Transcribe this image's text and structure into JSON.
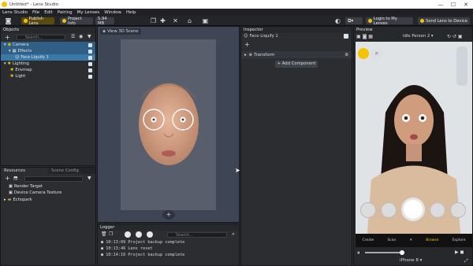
{
  "window": {
    "title": "Untitled* - Lens Studio",
    "minimize": "—",
    "maximize": "☐",
    "close": "✕"
  },
  "menu": [
    "Lens Studio",
    "File",
    "Edit",
    "Pairing",
    "My Lenses",
    "Window",
    "Help"
  ],
  "toolbar": {
    "publish": "Publish Lens",
    "project_info": "Project Info",
    "size": "5.94 MB",
    "login": "Login to My Lenses",
    "send": "Send Lens to Device"
  },
  "objects": {
    "title": "Objects",
    "search_placeholder": "Search...",
    "items": [
      {
        "label": "Camera"
      },
      {
        "label": "Effects"
      },
      {
        "label": "Face Liquify 1"
      },
      {
        "label": "Lighting"
      },
      {
        "label": "Envmap"
      },
      {
        "label": "Light"
      }
    ]
  },
  "viewport": {
    "tab": "View 3D Scene"
  },
  "resources": {
    "tab1": "Resources",
    "tab2": "Scene Config",
    "items": [
      {
        "label": "Render Target"
      },
      {
        "label": "Device Camera Texture"
      },
      {
        "label": "Echopark"
      }
    ]
  },
  "logger": {
    "title": "Logger",
    "search_placeholder": "Search...",
    "lines": [
      {
        "time": "10:13:09",
        "msg": "Project backup complete"
      },
      {
        "time": "10:13:46",
        "msg": "Lens reset"
      },
      {
        "time": "10:14:10",
        "msg": "Project backup complete"
      }
    ]
  },
  "inspector": {
    "title": "Inspector",
    "object": "Face Liquify 1",
    "section": "Transform",
    "add_component": "+ Add Component"
  },
  "preview": {
    "title": "Preview",
    "person": "Idle Person 2",
    "device": "iPhone 8",
    "bottom": [
      {
        "label": "Create"
      },
      {
        "label": "Scan"
      },
      {
        "label": ""
      },
      {
        "label": "Browse"
      },
      {
        "label": "Explore"
      }
    ]
  },
  "colors": {
    "selection": "#2f5f86",
    "accent": "#f5c400"
  }
}
